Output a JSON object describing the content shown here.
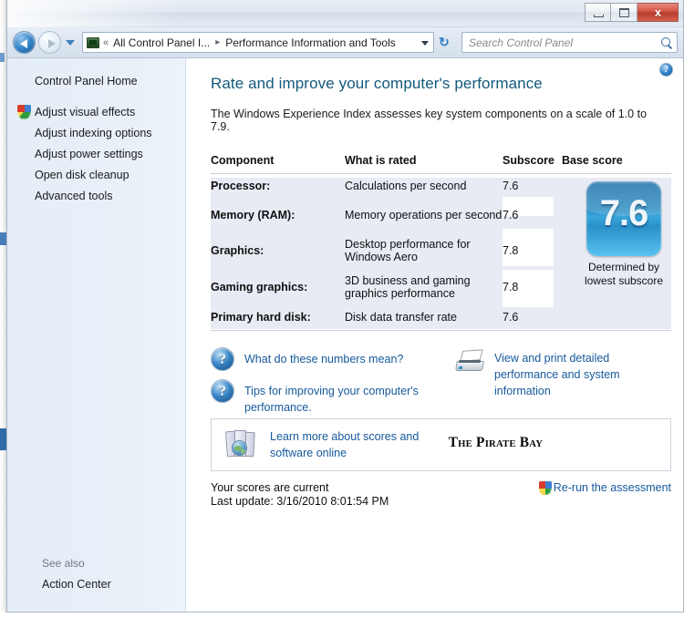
{
  "window": {
    "minimize_label": "—",
    "maximize_label": "□",
    "close_label": "x"
  },
  "nav": {
    "back_name": "back",
    "forward_name": "forward",
    "history_name": "recent-pages",
    "breadcrumb_chevron": "«",
    "breadcrumb_separator": "▸",
    "crumb1": "All Control Panel I...",
    "crumb2": "Performance Information and Tools",
    "refresh_glyph_1": "↻",
    "refresh_glyph_2": "↻",
    "search_placeholder": "Search Control Panel"
  },
  "sidebar": {
    "home_label": "Control Panel Home",
    "items": [
      {
        "label": "Adjust visual effects",
        "shield": true
      },
      {
        "label": "Adjust indexing options",
        "shield": false
      },
      {
        "label": "Adjust power settings",
        "shield": false
      },
      {
        "label": "Open disk cleanup",
        "shield": false
      },
      {
        "label": "Advanced tools",
        "shield": false
      }
    ],
    "see_also_title": "See also",
    "see_also_link": "Action Center"
  },
  "main": {
    "help_glyph": "?",
    "title": "Rate and improve your computer's performance",
    "intro": "The Windows Experience Index assesses key system components on a scale of 1.0 to 7.9.",
    "table": {
      "headers": [
        "Component",
        "What is rated",
        "Subscore",
        "Base score"
      ],
      "rows": [
        {
          "component": "Processor:",
          "rated": "Calculations per second",
          "subscore": "7.6"
        },
        {
          "component": "Memory (RAM):",
          "rated": "Memory operations per second",
          "subscore": "7.6"
        },
        {
          "component": "Graphics:",
          "rated": "Desktop performance for Windows Aero",
          "subscore": "7.8"
        },
        {
          "component": "Gaming graphics:",
          "rated": "3D business and gaming graphics performance",
          "subscore": "7.8"
        },
        {
          "component": "Primary hard disk:",
          "rated": "Disk data transfer rate",
          "subscore": "7.6"
        }
      ]
    },
    "base_score": {
      "value": "7.6",
      "caption_line1": "Determined by",
      "caption_line2": "lowest subscore"
    },
    "links": {
      "q_glyph": "?",
      "what_numbers_mean": "What do these numbers mean?",
      "tips_improving": "Tips for improving your computer's performance.",
      "view_and_print": "View and print detailed performance and system information"
    },
    "learn_more": {
      "link": "Learn more about scores and software online",
      "logo": "The Pirate Bay"
    },
    "status": {
      "line1": "Your scores are current",
      "line2": "Last update: 3/16/2010 8:01:54 PM",
      "rerun_label": "Re-run the assessment"
    }
  },
  "colors": {
    "accent_link": "#16599c",
    "title_blue": "#13597d",
    "table_band": "#e8ebf4",
    "tile_blue": "#2f8fc4"
  }
}
